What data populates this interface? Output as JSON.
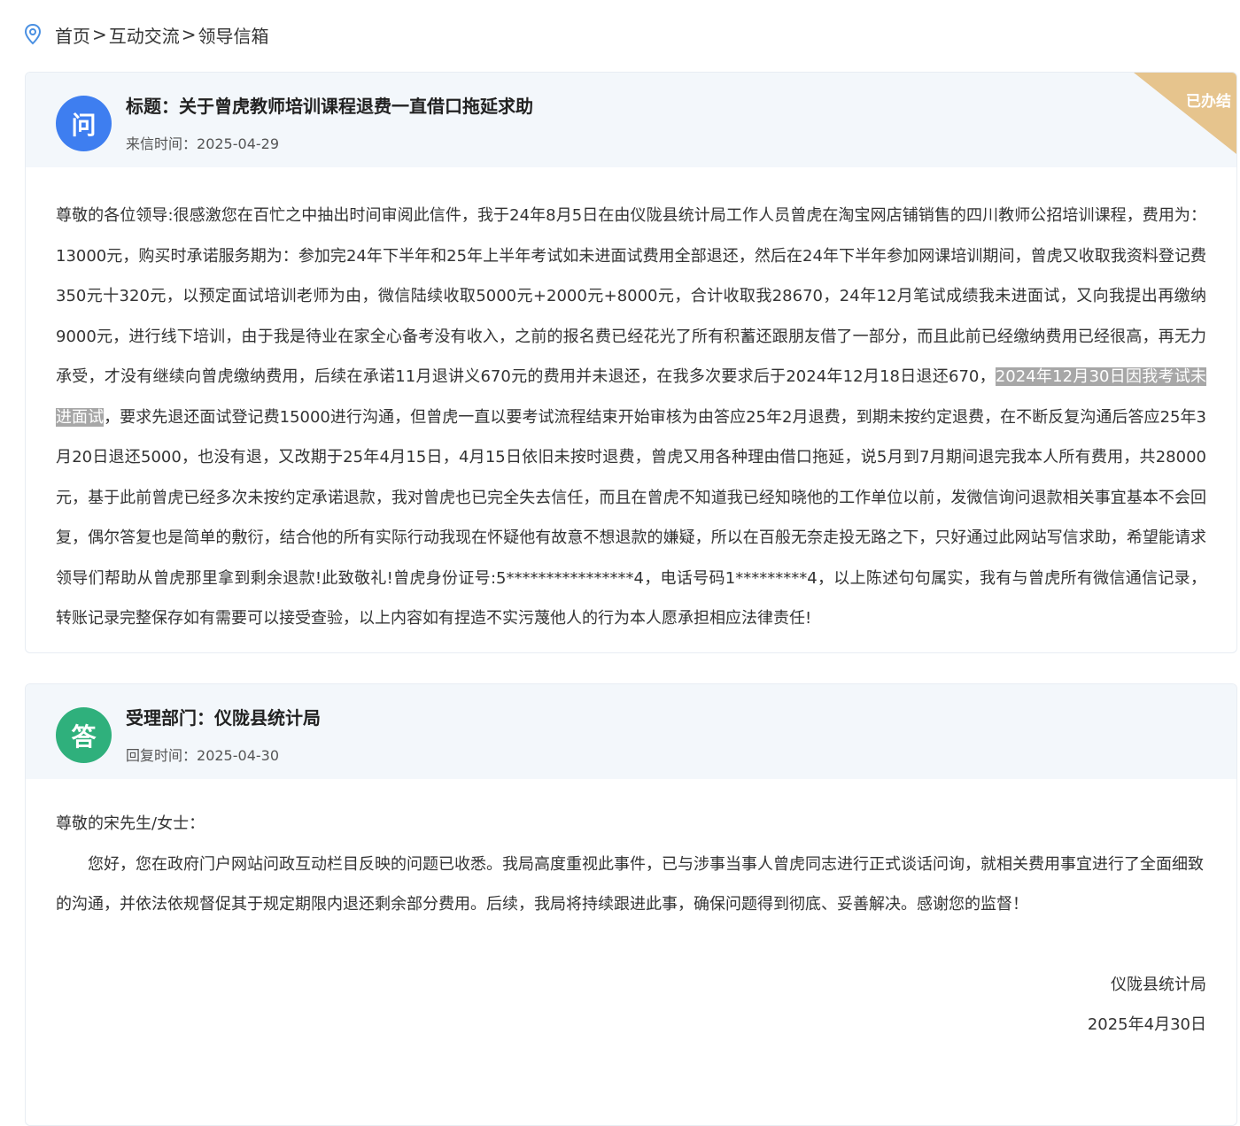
{
  "breadcrumb": {
    "home": "首页",
    "sep1": ">",
    "section": "互动交流",
    "sep2": ">",
    "current": "领导信箱"
  },
  "question": {
    "avatar": "问",
    "title": "标题：关于曾虎教师培训课程退费一直借口拖延求助",
    "time_label": "来信时间：",
    "time_value": "2025-04-29",
    "status": "已办结",
    "body_before": "尊敬的各位领导:很感激您在百忙之中抽出时间审阅此信件，我于24年8月5日在由仪陇县统计局工作人员曾虎在淘宝网店铺销售的四川教师公招培训课程，费用为：13000元，购买时承诺服务期为：参加完24年下半年和25年上半年考试如未进面试费用全部退还，然后在24年下半年参加网课培训期间，曾虎又收取我资料登记费350元十320元，以预定面试培训老师为由，微信陆续收取5000元+2000元+8000元，合计收取我28670，24年12月笔试成绩我未进面试，又向我提出再缴纳9000元，进行线下培训，由于我是待业在家全心备考没有收入，之前的报名费已经花光了所有积蓄还跟朋友借了一部分，而且此前已经缴纳费用已经很高，再无力承受，才没有继续向曾虎缴纳费用，后续在承诺11月退讲义670元的费用并未退还，在我多次要求后于2024年12月18日退还670，",
    "body_highlight": "2024年12月30日因我考试未进面试",
    "body_after": "，要求先退还面试登记费15000进行沟通，但曾虎一直以要考试流程结束开始审核为由答应25年2月退费，到期未按约定退费，在不断反复沟通后答应25年3月20日退还5000，也没有退，又改期于25年4月15日，4月15日依旧未按时退费，曾虎又用各种理由借口拖延，说5月到7月期间退完我本人所有费用，共28000元，基于此前曾虎已经多次未按约定承诺退款，我对曾虎也已完全失去信任，而且在曾虎不知道我已经知晓他的工作单位以前，发微信询问退款相关事宜基本不会回复，偶尔答复也是简单的敷衍，结合他的所有实际行动我现在怀疑他有故意不想退款的嫌疑，所以在百般无奈走投无路之下，只好通过此网站写信求助，希望能请求领导们帮助从曾虎那里拿到剩余退款!此致敬礼!曾虎身份证号:5****************4，电话号码1*********4，以上陈述句句属实，我有与曾虎所有微信通信记录，转账记录完整保存如有需要可以接受查验，以上内容如有捏造不实污蔑他人的行为本人愿承担相应法律责任!"
  },
  "answer": {
    "avatar": "答",
    "dept": "受理部门：仪陇县统计局",
    "time_label": "回复时间：",
    "time_value": "2025-04-30",
    "greeting": "尊敬的宋先生/女士：",
    "body": "您好，您在政府门户网站问政互动栏目反映的问题已收悉。我局高度重视此事件，已与涉事当事人曾虎同志进行正式谈话问询，就相关费用事宜进行了全面细致的沟通，并依法依规督促其于规定期限内退还剩余部分费用。后续，我局将持续跟进此事，确保问题得到彻底、妥善解决。感谢您的监督！",
    "sign_org": "仪陇县统计局",
    "sign_date": "2025年4月30日"
  },
  "colors": {
    "accent_blue": "#3e7ef0",
    "accent_green": "#2fb07c",
    "ribbon": "#e6c48d",
    "header_bg": "#f3f7fb"
  },
  "icons": {
    "location": "location-pin-icon"
  }
}
